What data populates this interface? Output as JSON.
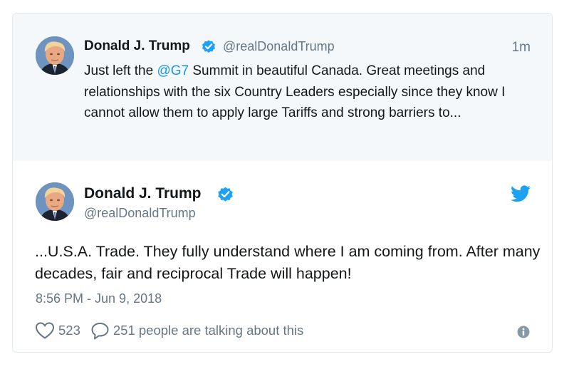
{
  "quoted": {
    "name": "Donald J. Trump",
    "handle": "@realDonaldTrump",
    "time": "1m",
    "text_before": "Just left the ",
    "mention": "@G7",
    "text_after": " Summit in beautiful Canada. Great meetings and relationships with the six Country Leaders especially since they know I cannot allow them to apply large Tariffs and strong barriers to..."
  },
  "main": {
    "name": "Donald J. Trump",
    "handle": "@realDonaldTrump",
    "text": "...U.S.A. Trade. They fully understand where I am coming from. After many decades, fair and reciprocal Trade will happen!",
    "timestamp": "8:56 PM - Jun 9, 2018"
  },
  "actions": {
    "like_count": "523",
    "reply_label": "251 people are talking about this"
  },
  "icons": {
    "verified": "verified-badge-icon",
    "bird": "twitter-bird-icon",
    "heart": "heart-icon",
    "reply": "reply-bubble-icon",
    "info": "info-icon"
  },
  "colors": {
    "accent": "#1da1f2",
    "mention": "#1b95e0",
    "muted": "#657786",
    "quoted_bg": "#f5f8fa"
  }
}
